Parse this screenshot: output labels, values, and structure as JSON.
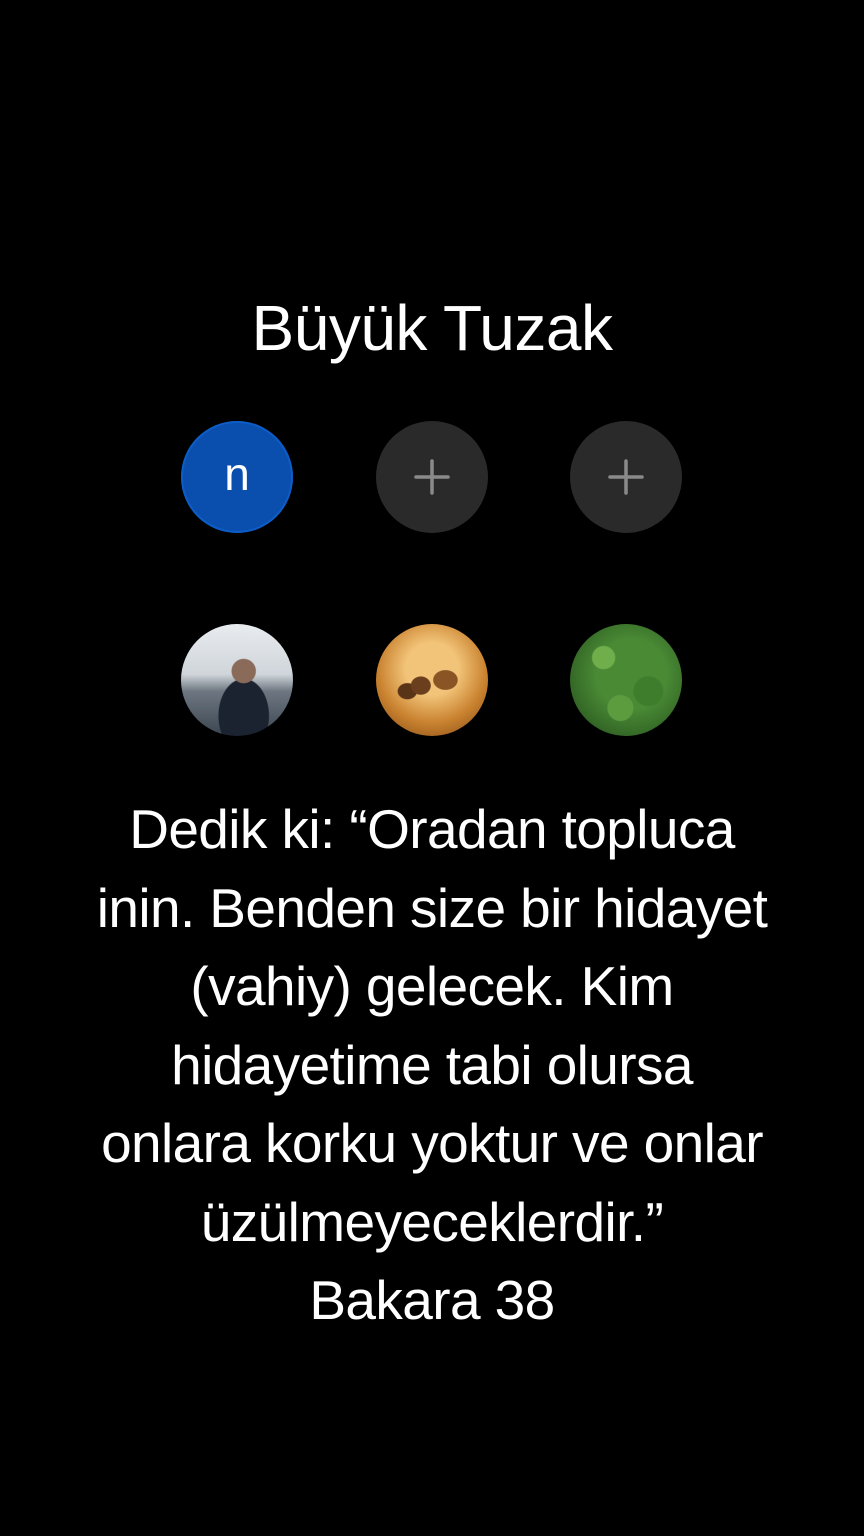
{
  "title": "Büyük Tuzak",
  "account_buttons": [
    {
      "label": "n",
      "type": "account"
    },
    {
      "label": "+",
      "type": "add"
    },
    {
      "label": "+",
      "type": "add"
    }
  ],
  "profile_avatars": [
    {
      "icon": "person-photo-avatar"
    },
    {
      "icon": "desert-scene-avatar"
    },
    {
      "icon": "green-field-avatar"
    }
  ],
  "verse_lines": [
    "Dedik ki: “Oradan topluca",
    "inin. Benden size bir hidayet",
    "(vahiy) gelecek. Kim",
    "hidayetime tabi olursa",
    "onlara korku yoktur ve onlar",
    "üzülmeyeceklerdir.”",
    "Bakara 38"
  ],
  "colors": {
    "background": "#000000",
    "text": "#ffffff",
    "account_blue": "#0a4fae",
    "add_button": "#2a2a2a",
    "plus_icon": "#8a8a8a"
  }
}
